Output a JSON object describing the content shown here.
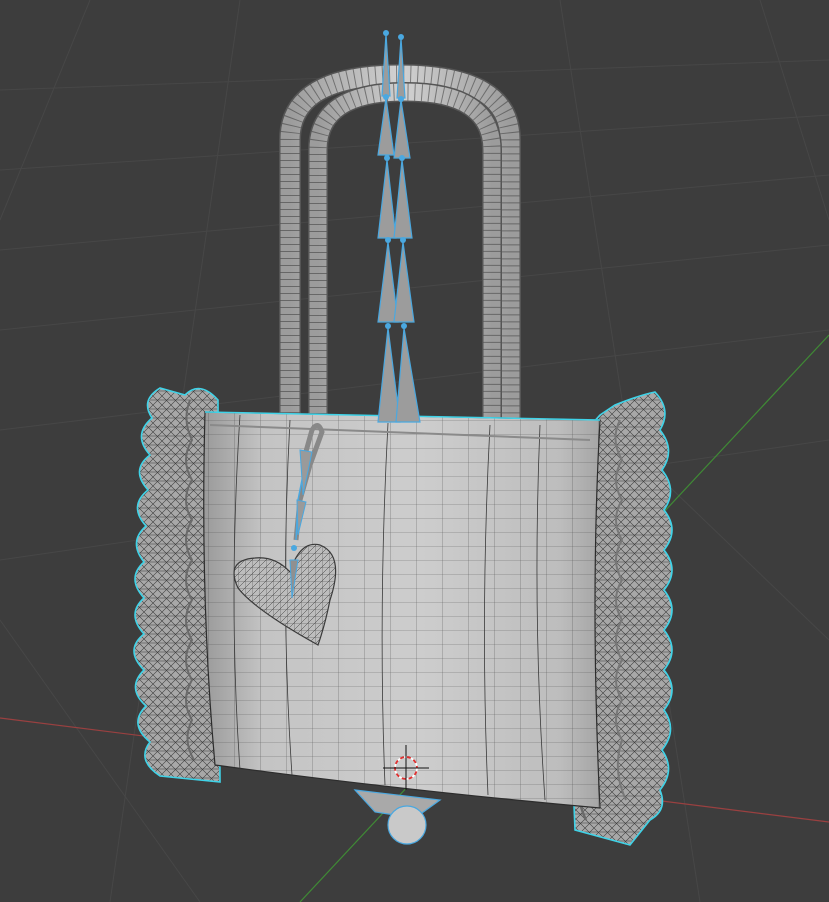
{
  "viewport": {
    "background": "#3d3d3d",
    "grid_color": "#4a4a4a",
    "x_axis_color": "#b34a4a",
    "y_axis_color": "#4a9a3a",
    "selection_outline_color": "#3fd3e8",
    "bone_selected_color": "#4aa8e0",
    "mesh_surface_color": "#c6c6c6",
    "wire_color": "#2b2b2b"
  },
  "scene": {
    "objects": [
      {
        "name": "bag-body-icon"
      },
      {
        "name": "handle-icon"
      },
      {
        "name": "ruffle-left-icon"
      },
      {
        "name": "ruffle-right-icon"
      },
      {
        "name": "heart-charm-icon"
      },
      {
        "name": "armature-bones-icon"
      },
      {
        "name": "3d-cursor-icon"
      }
    ]
  }
}
